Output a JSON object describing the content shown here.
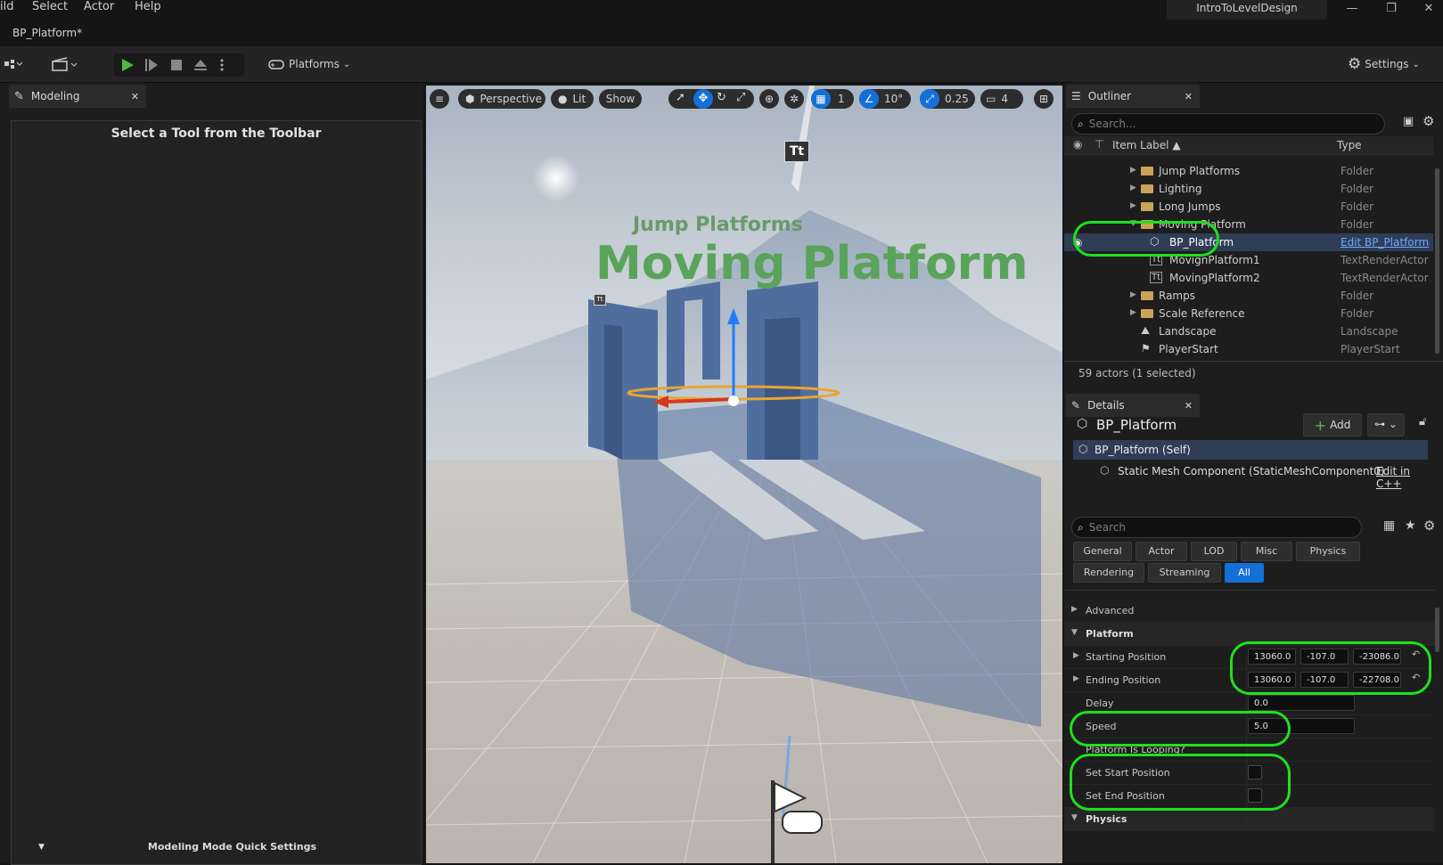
{
  "menu": {
    "items": [
      "ild",
      "Select",
      "Actor",
      "Help"
    ]
  },
  "window": {
    "project": "IntroToLevelDesign",
    "minimize": "—",
    "restore": "❐",
    "close": "✕"
  },
  "doc_tab": {
    "label": "BP_Platform*"
  },
  "toolbar": {
    "platforms_label": "Platforms",
    "settings_label": "Settings"
  },
  "modeling": {
    "tab_label": "Modeling",
    "tool_hint": "Select a Tool from the Toolbar",
    "quick_settings": "Modeling Mode Quick Settings"
  },
  "viewport": {
    "perspective": "Perspective",
    "lit": "Lit",
    "show": "Show",
    "grid_value": "1",
    "angle_value": "10°",
    "scale_value": "0.25",
    "camera_speed": "4",
    "text_jump": "Jump Platforms",
    "text_moving": "Moving Platform",
    "tt_glyph": "Tt"
  },
  "outliner": {
    "tab_label": "Outliner",
    "search_placeholder": "Search...",
    "col_label": "Item Label ▲",
    "col_type": "Type",
    "rows": [
      {
        "label": "Jump Platforms",
        "type": "Folder"
      },
      {
        "label": "Lighting",
        "type": "Folder"
      },
      {
        "label": "Long Jumps",
        "type": "Folder"
      },
      {
        "label": "Moving Platform",
        "type": "Folder"
      },
      {
        "label": "BP_Platform",
        "type": "Edit BP_Platform"
      },
      {
        "label": "MovignPlatform1",
        "type": "TextRenderActor"
      },
      {
        "label": "MovingPlatform2",
        "type": "TextRenderActor"
      },
      {
        "label": "Ramps",
        "type": "Folder"
      },
      {
        "label": "Scale Reference",
        "type": "Folder"
      },
      {
        "label": "Landscape",
        "type": "Landscape"
      },
      {
        "label": "PlayerStart",
        "type": "PlayerStart"
      }
    ],
    "status": "59 actors (1 selected)"
  },
  "details": {
    "tab_label": "Details",
    "actor_name": "BP_Platform",
    "add_label": "Add",
    "self_label": "BP_Platform (Self)",
    "component_label": "Static Mesh Component (StaticMeshComponent0)",
    "edit_cpp": "Edit in C++",
    "search_placeholder": "Search",
    "filters_row1": [
      "General",
      "Actor",
      "LOD",
      "Misc",
      "Physics"
    ],
    "filters_row2": [
      "Rendering",
      "Streaming",
      "All"
    ],
    "advanced_label": "Advanced",
    "platform_label": "Platform",
    "starting_position": {
      "label": "Starting Position",
      "x": "13060.0",
      "y": "-107.0",
      "z": "-23086.0"
    },
    "ending_position": {
      "label": "Ending Position",
      "x": "13060.0",
      "y": "-107.0",
      "z": "-22708.0"
    },
    "delay": {
      "label": "Delay",
      "value": "0.0"
    },
    "speed": {
      "label": "Speed",
      "value": "5.0"
    },
    "looping": {
      "label": "Platform Is Looping?"
    },
    "set_start": {
      "label": "Set Start Position"
    },
    "set_end": {
      "label": "Set End Position"
    },
    "physics_label": "Physics"
  },
  "colors": {
    "accent": "#1470d8",
    "highlight": "#1ee01e",
    "selected_row": "#2f3d56"
  }
}
